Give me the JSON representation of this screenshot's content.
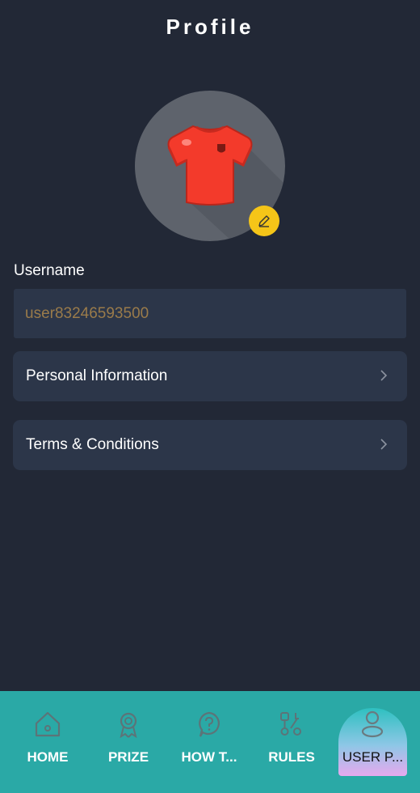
{
  "header": {
    "title": "Profile"
  },
  "avatar": {
    "icon": "jersey-icon",
    "jersey_color": "#f33a2b",
    "edit_icon": "pencil-icon",
    "badge_color": "#f5c518"
  },
  "username": {
    "label": "Username",
    "value": "user83246593500"
  },
  "menu": [
    {
      "label": "Personal Information",
      "icon": "chevron-right-icon"
    },
    {
      "label": "Terms & Conditions",
      "icon": "chevron-right-icon"
    }
  ],
  "nav": {
    "accent": "#2aa9a6",
    "items": [
      {
        "label": "HOME",
        "icon": "home-icon"
      },
      {
        "label": "PRIZE",
        "icon": "award-icon"
      },
      {
        "label": "HOW T...",
        "icon": "question-icon"
      },
      {
        "label": "RULES",
        "icon": "rules-icon"
      },
      {
        "label": "USER P...",
        "icon": "user-icon",
        "active": true
      }
    ]
  }
}
